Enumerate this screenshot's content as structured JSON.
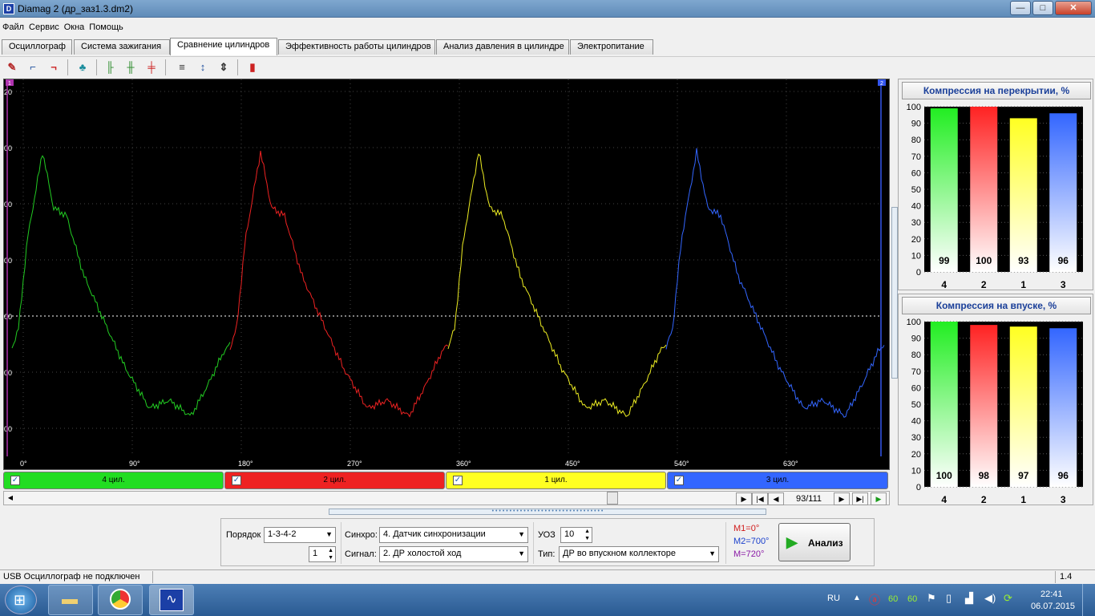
{
  "window": {
    "title": "Diamag 2 (др_заз1.3.dm2)",
    "icon": "app-icon",
    "minimize": "—",
    "maximize": "□",
    "close": "✕"
  },
  "menu": [
    "Файл",
    "Сервис",
    "Окна",
    "Помощь"
  ],
  "tabs": [
    "Осциллограф",
    "Система зажигания",
    "Сравнение цилиндров",
    "Эффективность работы цилиндров",
    "Анализ давления в цилиндре",
    "Электропитание"
  ],
  "active_tab": 2,
  "toolbar_icons": [
    "zoom-icon",
    "rising-edge-icon",
    "falling-edge-icon",
    "probe-icon",
    "markers-icon",
    "cursor-icon",
    "balance-icon",
    "lines-icon",
    "vertical-scale-icon",
    "horizontal-scale-icon",
    "report-icon"
  ],
  "scope": {
    "marker_left": "1",
    "marker_right": "2",
    "x_ticks": [
      "0°",
      "90°",
      "180°",
      "270°",
      "360°",
      "450°",
      "540°",
      "630°"
    ],
    "y_ticks": [
      "20",
      "00",
      "00",
      "00",
      "00",
      "00",
      "00"
    ],
    "waves": [
      {
        "name": "4 цил.",
        "color": "#22cc22"
      },
      {
        "name": "2 цил.",
        "color": "#ee2222"
      },
      {
        "name": "1 цил.",
        "color": "#eeee22"
      },
      {
        "name": "3 цил.",
        "color": "#3366ff"
      }
    ]
  },
  "channels": [
    {
      "label": "4 цил.",
      "color": "#22dd22",
      "checked": true
    },
    {
      "label": "2 цил.",
      "color": "#ee2222",
      "checked": true
    },
    {
      "label": "1 цил.",
      "color": "#ffff22",
      "checked": true
    },
    {
      "label": "3 цил.",
      "color": "#3366ff",
      "checked": true
    }
  ],
  "nav": {
    "position": "93/111"
  },
  "chart_data": [
    {
      "type": "bar",
      "title": "Компрессия на перекрытии, %",
      "categories": [
        "4",
        "2",
        "1",
        "3"
      ],
      "values": [
        99,
        100,
        93,
        96
      ],
      "colors": [
        "#22ee22",
        "#ff2222",
        "#ffff22",
        "#3366ff"
      ],
      "ylim": [
        0,
        100
      ],
      "yticks": [
        "100",
        "90",
        "80",
        "70",
        "60",
        "50",
        "40",
        "30",
        "20",
        "10",
        "0"
      ],
      "grid": true
    },
    {
      "type": "bar",
      "title": "Компрессия на впуске, %",
      "categories": [
        "4",
        "2",
        "1",
        "3"
      ],
      "values": [
        100,
        98,
        97,
        96
      ],
      "colors": [
        "#22ee22",
        "#ff2222",
        "#ffff22",
        "#3366ff"
      ],
      "ylim": [
        0,
        100
      ],
      "yticks": [
        "100",
        "90",
        "80",
        "70",
        "60",
        "50",
        "40",
        "30",
        "20",
        "10",
        "0"
      ],
      "grid": true
    }
  ],
  "settings": {
    "order_label": "Порядок",
    "order_value": "1-3-4-2",
    "cyl_value": "1",
    "sync_label": "Синхро:",
    "sync_value": "4.  Датчик синхронизации",
    "signal_label": "Сигнал:",
    "signal_value": "2.  ДР холостой ход",
    "uoz_label": "УОЗ",
    "uoz_value": "10",
    "type_label": "Тип:",
    "type_value": "ДР во впускном коллекторе",
    "m1": "M1=0°",
    "m2": "M2=700°",
    "m3": "M=720°",
    "analyze": "Анализ"
  },
  "status": {
    "left": "USB Осциллограф не подключен",
    "right": "1.4"
  },
  "taskbar": {
    "lang": "RU",
    "time": "22:41",
    "date": "06.07.2015",
    "tray_a": "60",
    "tray_b": "60"
  }
}
